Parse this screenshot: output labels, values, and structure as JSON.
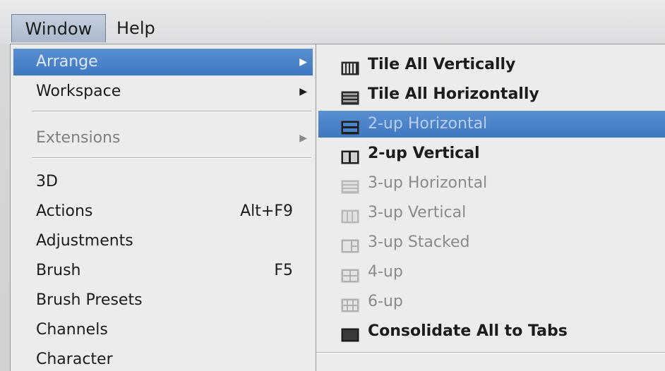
{
  "menubar": {
    "items": [
      "Window",
      "Help"
    ]
  },
  "window_menu": {
    "items": [
      {
        "label": "Arrange",
        "submenu": true,
        "state": "highlighted"
      },
      {
        "label": "Workspace",
        "submenu": true,
        "state": "normal"
      },
      {
        "label": "Extensions",
        "submenu": true,
        "state": "disabled"
      },
      {
        "label": "3D",
        "shortcut": ""
      },
      {
        "label": "Actions",
        "shortcut": "Alt+F9"
      },
      {
        "label": "Adjustments",
        "shortcut": ""
      },
      {
        "label": "Brush",
        "shortcut": "F5"
      },
      {
        "label": "Brush Presets",
        "shortcut": ""
      },
      {
        "label": "Channels",
        "shortcut": ""
      },
      {
        "label": "Character",
        "shortcut": ""
      }
    ]
  },
  "arrange_submenu": {
    "items": [
      {
        "label": "Tile All Vertically",
        "icon": "tile-vertical-icon",
        "state": "bold"
      },
      {
        "label": "Tile All Horizontally",
        "icon": "tile-horizontal-icon",
        "state": "bold"
      },
      {
        "label": "2-up Horizontal",
        "icon": "two-up-horizontal-icon",
        "state": "highlighted"
      },
      {
        "label": "2-up Vertical",
        "icon": "two-up-vertical-icon",
        "state": "bold"
      },
      {
        "label": "3-up Horizontal",
        "icon": "three-up-horizontal-icon",
        "state": "disabled"
      },
      {
        "label": "3-up Vertical",
        "icon": "three-up-vertical-icon",
        "state": "disabled"
      },
      {
        "label": "3-up Stacked",
        "icon": "three-up-stacked-icon",
        "state": "disabled"
      },
      {
        "label": "4-up",
        "icon": "four-up-icon",
        "state": "disabled"
      },
      {
        "label": "6-up",
        "icon": "six-up-icon",
        "state": "disabled"
      },
      {
        "label": "Consolidate All to Tabs",
        "icon": "consolidate-tabs-icon",
        "state": "bold"
      }
    ]
  },
  "colors": {
    "highlight": "#4a84c9",
    "menu_bg": "#ececec",
    "disabled_text": "#8a8a8a"
  }
}
